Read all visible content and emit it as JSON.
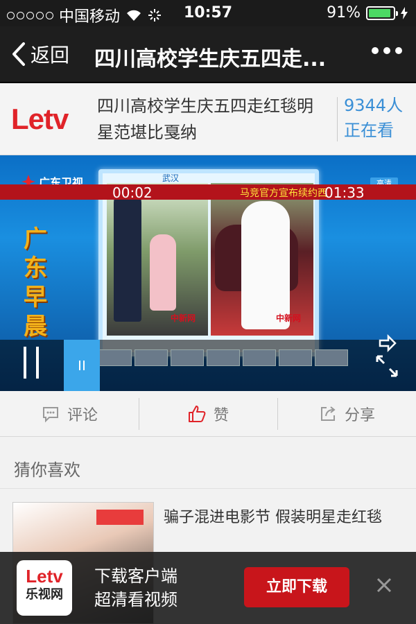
{
  "status": {
    "carrier": "中国移动",
    "time": "10:57",
    "battery": "91%"
  },
  "nav": {
    "back_label": "返回",
    "title": "四川高校学生庆五四走..."
  },
  "program": {
    "title": "四川高校学生庆五四走红毯明星范堪比戛纳",
    "viewer_count": "9344人",
    "viewer_suffix": "正在看"
  },
  "video": {
    "channel": "广东卫视",
    "show_name": "广东早晨",
    "city": "武汉",
    "hd_badge": "高清",
    "watermark": "中新网",
    "ticker": "马竞官方宣布续约西",
    "time_current": "00:02",
    "time_total": "01:33"
  },
  "actions": {
    "comment": "评论",
    "like": "赞",
    "share": "分享"
  },
  "recommend": {
    "heading": "猜你喜欢",
    "items": [
      {
        "title": "骗子混进电影节 假装明星走红毯"
      }
    ]
  },
  "banner": {
    "line1": "下载客户端",
    "line2": "超清看视频",
    "button": "立即下载",
    "app_name": "乐视网"
  },
  "colors": {
    "brand_red": "#e02329",
    "viewer_blue": "#3a8fd6",
    "progress_blue": "#3ba6ea",
    "battery_green": "#4cd964"
  }
}
